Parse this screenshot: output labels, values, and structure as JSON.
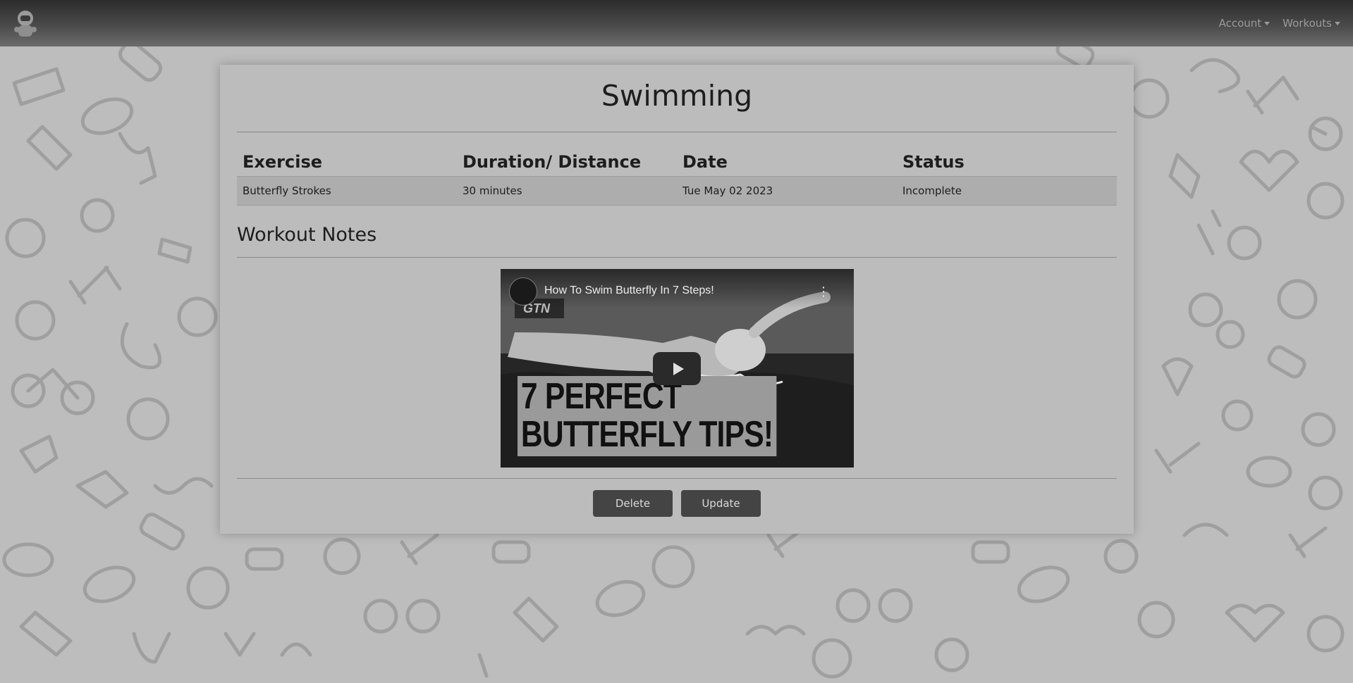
{
  "nav": {
    "items": [
      {
        "label": "Account"
      },
      {
        "label": "Workouts"
      }
    ]
  },
  "workout": {
    "title": "Swimming",
    "table": {
      "headers": [
        "Exercise",
        "Duration/ Distance",
        "Date",
        "Status"
      ],
      "rows": [
        [
          "Butterfly Strokes",
          "30 minutes",
          "Tue May 02 2023",
          "Incomplete"
        ]
      ]
    },
    "notes_heading": "Workout Notes",
    "video": {
      "title": "How To Swim Butterfly In 7 Steps!",
      "channel": "GTN",
      "thumbnail_text": [
        "7 PERFECT",
        "BUTTERFLY TIPS!"
      ]
    },
    "actions": {
      "delete_label": "Delete",
      "update_label": "Update"
    }
  }
}
